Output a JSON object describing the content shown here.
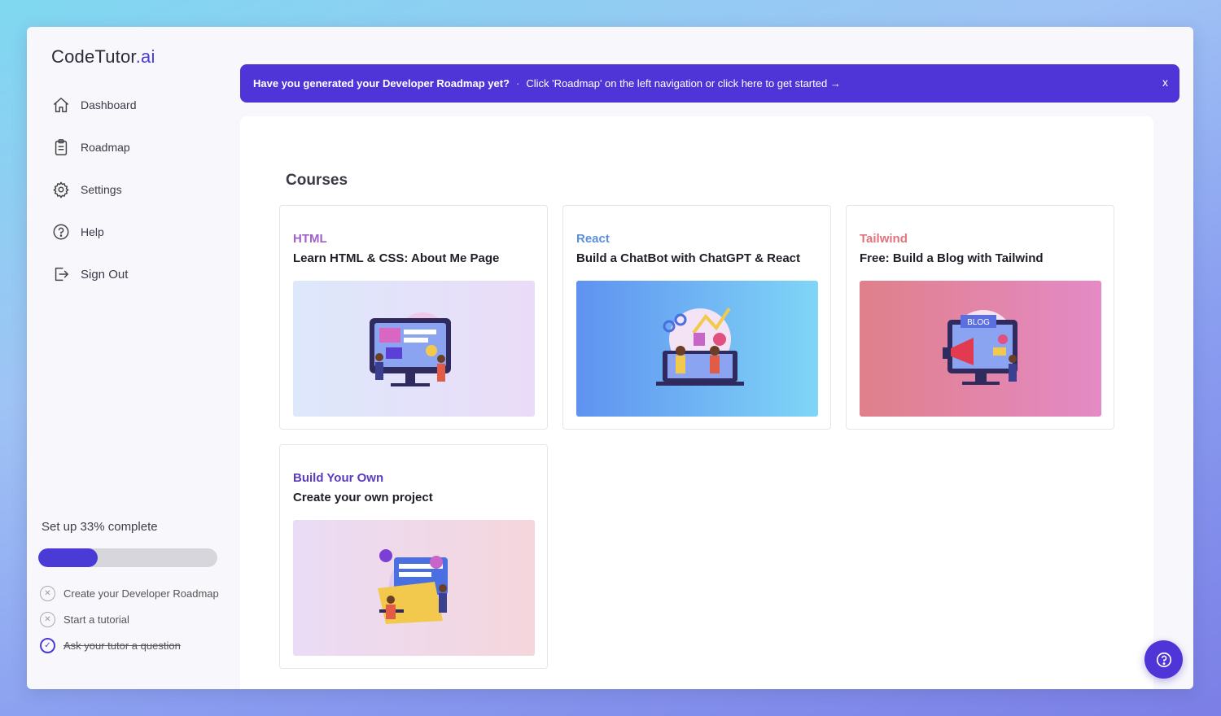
{
  "app": {
    "logo_main": "CodeTutor",
    "logo_suffix": ".ai"
  },
  "sidebar": {
    "items": [
      {
        "label": "Dashboard",
        "icon": "home-icon"
      },
      {
        "label": "Roadmap",
        "icon": "clipboard-icon"
      },
      {
        "label": "Settings",
        "icon": "gear-icon"
      },
      {
        "label": "Help",
        "icon": "question-circle-icon"
      },
      {
        "label": "Sign Out",
        "icon": "sign-out-icon"
      }
    ]
  },
  "setup": {
    "title": "Set up 33% complete",
    "progress_fraction": 0.33,
    "tasks": [
      {
        "label": "Create your Developer Roadmap",
        "done": false
      },
      {
        "label": "Start a tutorial",
        "done": false
      },
      {
        "label": "Ask your tutor a question",
        "done": true
      }
    ]
  },
  "banner": {
    "question": "Have you generated your Developer Roadmap yet?",
    "separator": "·",
    "instruction": "Click 'Roadmap' on the left navigation or click here to get started →",
    "close": "x"
  },
  "courses": {
    "title": "Courses",
    "cards": [
      {
        "category": "HTML",
        "title": "Learn HTML & CSS: About Me Page",
        "category_color": "#a261c9"
      },
      {
        "category": "React",
        "title": "Build a ChatBot with ChatGPT & React",
        "category_color": "#5b8fd9"
      },
      {
        "category": "Tailwind",
        "title": "Free: Build a Blog with Tailwind",
        "category_color": "#e0737d"
      },
      {
        "category": "Build Your Own",
        "title": "Create your own project",
        "category_color": "#5a3bbf"
      }
    ]
  },
  "colors": {
    "accent": "#4f35d8",
    "progress_track": "#d6d6dc"
  }
}
